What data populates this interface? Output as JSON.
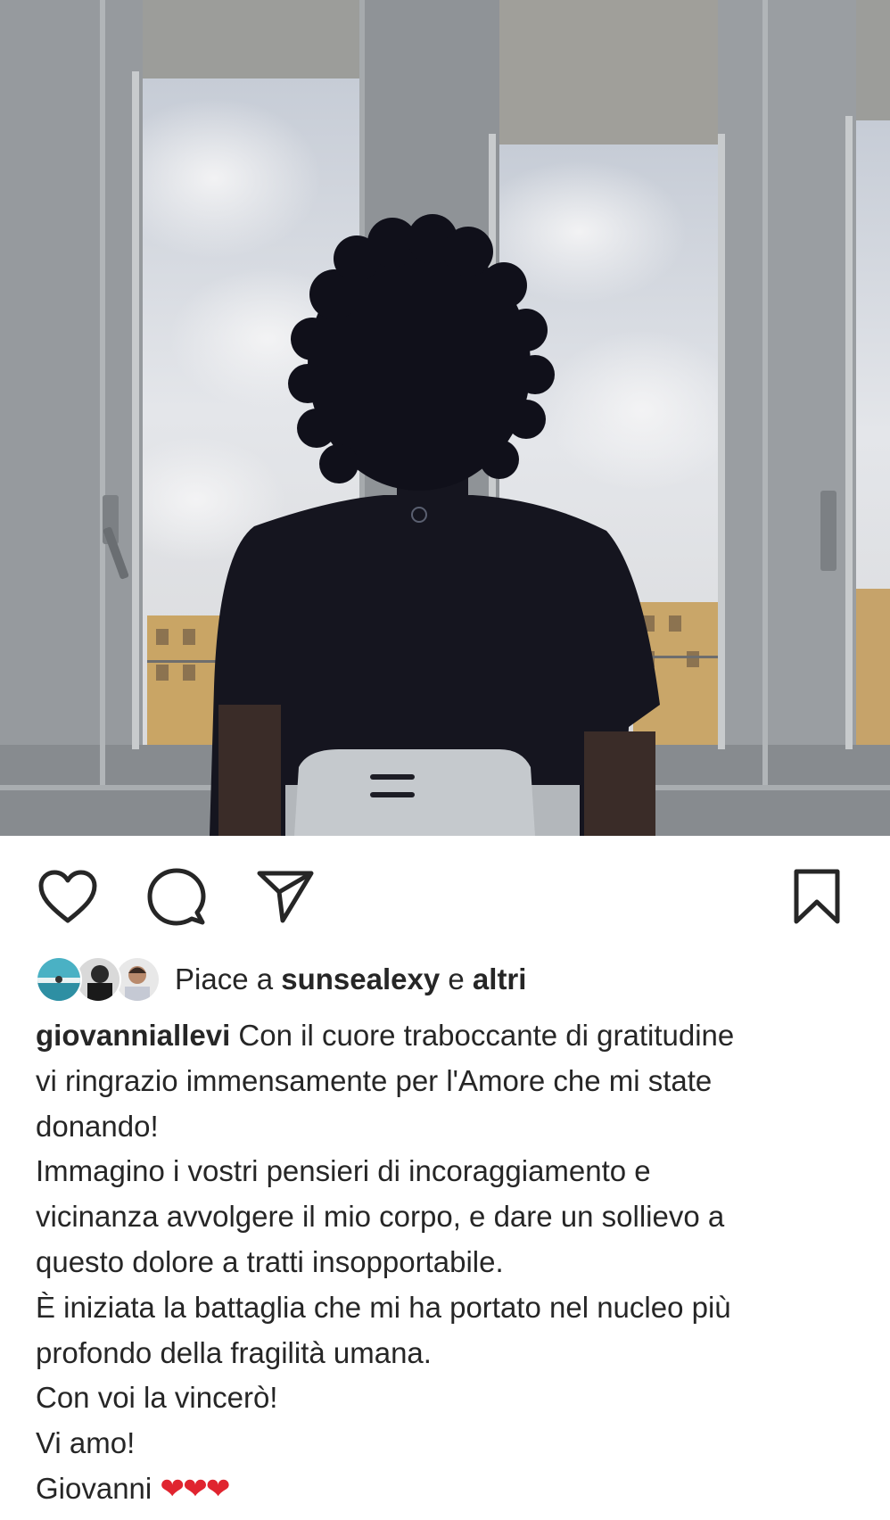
{
  "post": {
    "username": "giovanniallevi",
    "likes": {
      "prefix": "Piace a",
      "user": "sunsealexy",
      "conjunction": "e",
      "others": "altri"
    },
    "caption": {
      "first_line_text": "Con il cuore traboccante di gratitudine",
      "lines": [
        "vi ringrazio immensamente per l'Amore che mi state",
        "donando!",
        "Immagino i vostri pensieri di incoraggiamento e",
        "vicinanza avvolgere il mio corpo, e dare un sollievo a",
        "questo dolore a tratti insopportabile.",
        "È iniziata la battaglia che mi ha portato nel nucleo più",
        "profondo della fragilità umana.",
        "Con voi la vincerò!",
        "Vi amo!"
      ],
      "signature": "Giovanni",
      "emoji": "❤❤❤"
    }
  },
  "icons": {
    "like": "heart-outline-icon",
    "comment": "comment-bubble-icon",
    "share": "paper-plane-icon",
    "save": "bookmark-outline-icon"
  },
  "colors": {
    "text": "#262626",
    "heart_emoji": "#e0242f",
    "background": "#ffffff"
  }
}
